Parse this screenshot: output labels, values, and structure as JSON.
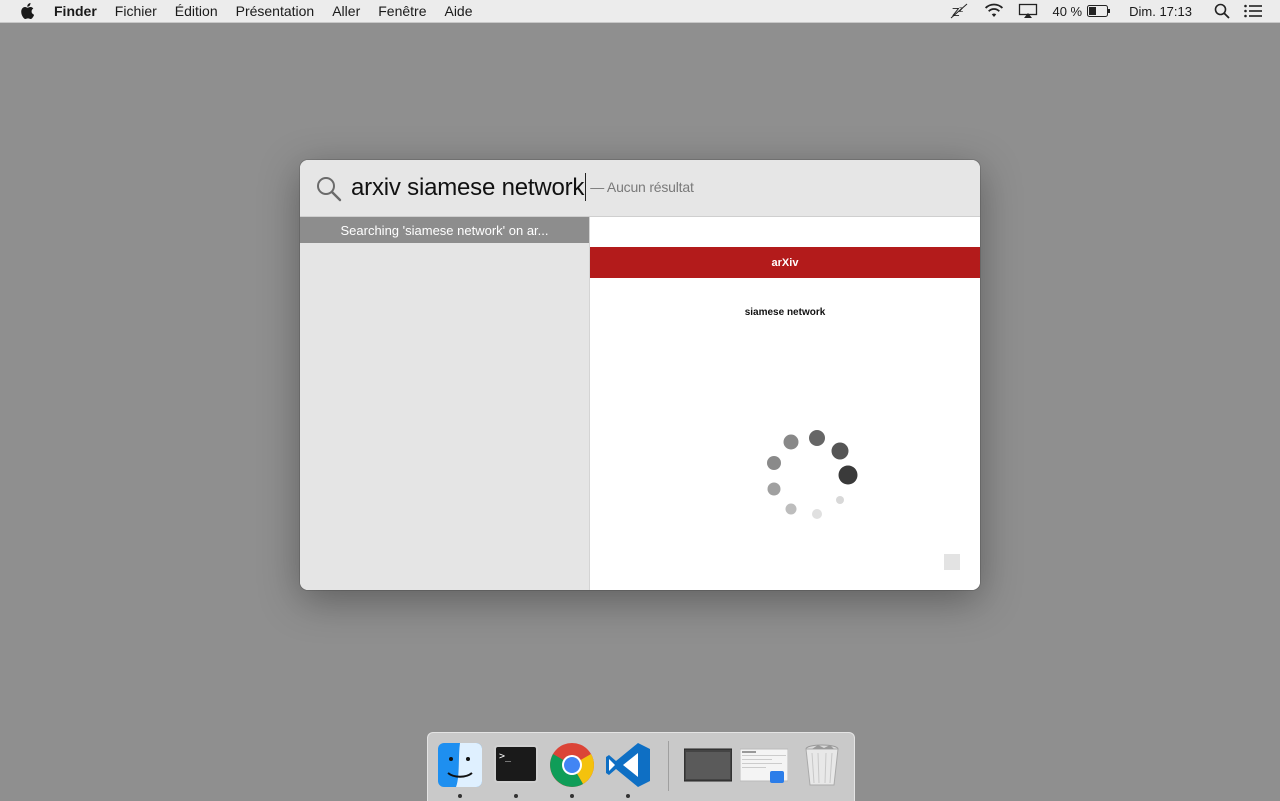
{
  "menubar": {
    "app_name": "Finder",
    "menus": [
      "Fichier",
      "Édition",
      "Présentation",
      "Aller",
      "Fenêtre",
      "Aide"
    ],
    "battery_percent": "40 %",
    "clock": "Dim. 17:13",
    "status_icons": [
      "sleep-zz-icon",
      "wifi-icon",
      "airplay-icon",
      "battery-icon",
      "spotlight-icon",
      "notification-center-icon"
    ]
  },
  "spotlight": {
    "query": "arxiv siamese network",
    "hint": "— Aucun résultat",
    "results": [
      {
        "label": "Searching 'siamese network' on ar...",
        "selected": true
      }
    ],
    "preview": {
      "banner": "arXiv",
      "banner_color": "#b31b1b",
      "title": "siamese network"
    }
  },
  "dock": {
    "apps": [
      "finder-icon",
      "terminal-icon",
      "chrome-icon",
      "vscode-icon"
    ],
    "running": [
      true,
      true,
      true,
      true
    ],
    "others": [
      "window-thumbnail-icon",
      "document-thumbnail-icon",
      "trash-icon"
    ]
  }
}
